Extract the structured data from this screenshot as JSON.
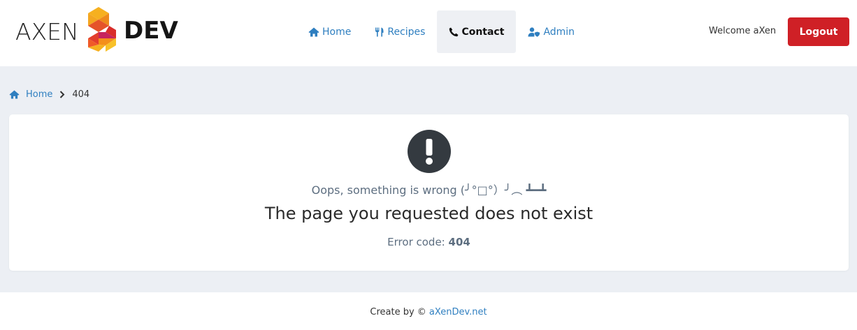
{
  "header": {
    "logo": {
      "left_text": "AXEN",
      "right_text": "DEV"
    },
    "nav": [
      {
        "label": "Home",
        "icon": "home-icon",
        "active": false
      },
      {
        "label": "Recipes",
        "icon": "utensils-icon",
        "active": false
      },
      {
        "label": "Contact",
        "icon": "phone-icon",
        "active": true
      },
      {
        "label": "Admin",
        "icon": "user-shield-icon",
        "active": false
      }
    ],
    "welcome": "Welcome aXen",
    "logout_label": "Logout"
  },
  "breadcrumb": {
    "home_label": "Home",
    "current": "404"
  },
  "error": {
    "icon": "exclamation-circle-icon",
    "oops": "Oops, something is wrong (╯°□°）╯︵ ┻━┻",
    "headline": "The page you requested does not exist",
    "code_label": "Error code:",
    "code_value": "404"
  },
  "footer": {
    "prefix": "Create by ©",
    "link": "aXenDev.net"
  },
  "colors": {
    "accent": "#2f7fc0",
    "logout": "#cf2026",
    "page_bg": "#eceff4",
    "active_nav_bg": "#eef0f4"
  }
}
